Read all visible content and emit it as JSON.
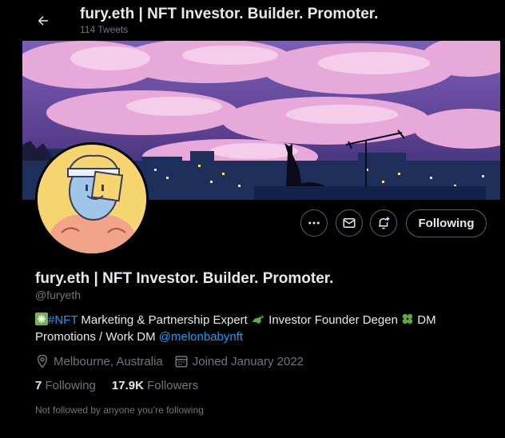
{
  "header": {
    "title": "fury.eth | NFT Investor. Builder. Promoter.",
    "tweet_count": "114 Tweets"
  },
  "profile": {
    "display_name": "fury.eth | NFT Investor. Builder. Promoter.",
    "handle": "@furyeth",
    "bio": {
      "hashtag": "#NFT",
      "text1": " Marketing & Partnership Expert ",
      "text2": " Investor Founder Degen ",
      "text3": " DM Promotions / Work DM ",
      "mention": "@melonbabynft"
    },
    "location": "Melbourne, Australia",
    "joined": "Joined January 2022",
    "following_count": "7",
    "following_label": "Following",
    "followers_count": "17.9K",
    "followers_label": "Followers",
    "not_followed_text": "Not followed by anyone you’re following"
  },
  "actions": {
    "following_button": "Following"
  },
  "colors": {
    "background": "#000000",
    "text": "#e7e9ea",
    "muted": "#71767b",
    "link": "#1d9bf0",
    "border": "#536471"
  },
  "icons": {
    "back": "arrow-left-icon",
    "more": "more-horizontal-icon",
    "message": "envelope-icon",
    "notify": "bell-plus-icon",
    "location": "location-pin-icon",
    "calendar": "calendar-icon"
  }
}
